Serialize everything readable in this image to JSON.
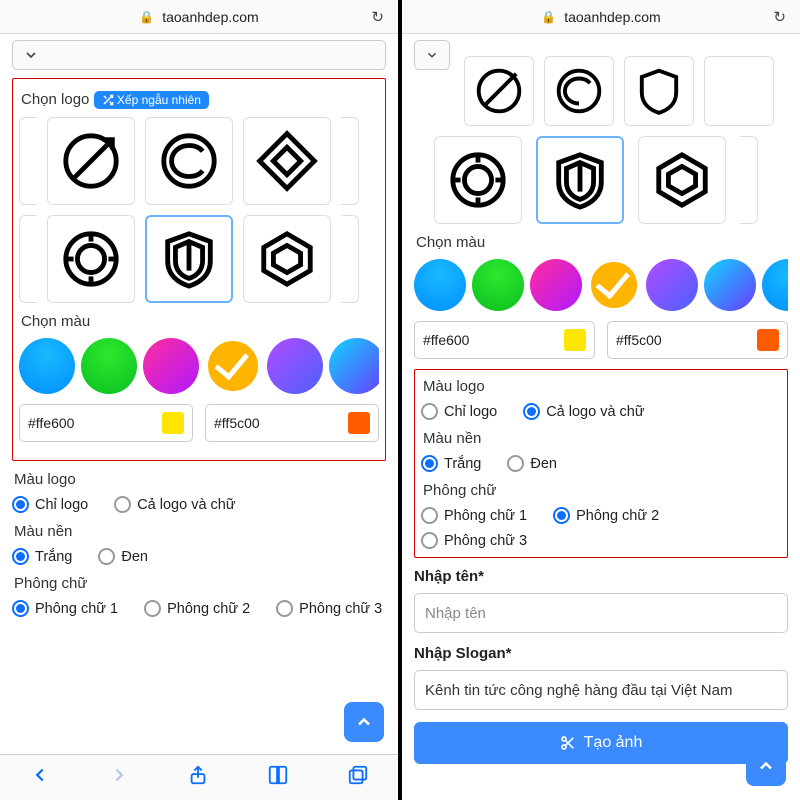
{
  "site_url": "taoanhdep.com",
  "left": {
    "choose_logo_label": "Chọn logo",
    "shuffle_label": "Xếp ngẫu nhiên",
    "choose_color_label": "Chọn màu",
    "hex1": "#ffe600",
    "hex2": "#ff5c00",
    "color_logo_title": "Màu logo",
    "color_logo_opts": [
      "Chỉ logo",
      "Cả logo và chữ"
    ],
    "color_logo_selected": 0,
    "bg_title": "Màu nền",
    "bg_opts": [
      "Trắng",
      "Đen"
    ],
    "bg_selected": 0,
    "font_title": "Phông chữ",
    "font_opts": [
      "Phông chữ 1",
      "Phông chữ 2",
      "Phông chữ 3"
    ],
    "font_selected": 0
  },
  "right": {
    "choose_color_label": "Chọn màu",
    "hex1": "#ffe600",
    "hex2": "#ff5c00",
    "color_logo_title": "Màu logo",
    "color_logo_opts": [
      "Chỉ logo",
      "Cả logo và chữ"
    ],
    "color_logo_selected": 1,
    "bg_title": "Màu nền",
    "bg_opts": [
      "Trắng",
      "Đen"
    ],
    "bg_selected": 0,
    "font_title": "Phông chữ",
    "font_opts": [
      "Phông chữ 1",
      "Phông chữ 2",
      "Phông chữ 3"
    ],
    "font_selected": 1,
    "name_label": "Nhập tên*",
    "name_placeholder": "Nhập tên",
    "slogan_label": "Nhập Slogan*",
    "slogan_value": "Kênh tin tức công nghệ hàng đầu tại Việt Nam",
    "create_label": "Tạo ảnh"
  },
  "colors": {
    "chip1": "#ffe600",
    "chip2": "#ff5c00"
  }
}
